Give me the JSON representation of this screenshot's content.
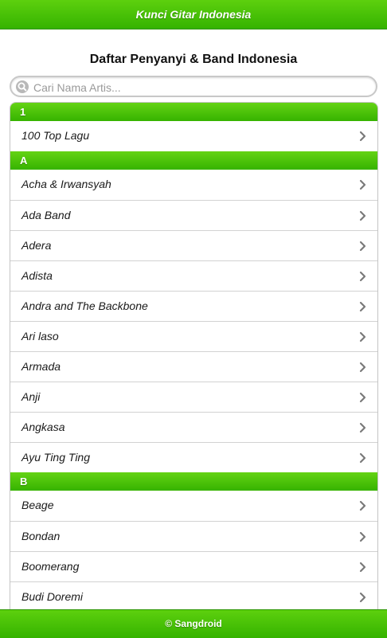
{
  "header": {
    "title": "Kunci Gitar Indonesia"
  },
  "page": {
    "title": "Daftar Penyanyi & Band Indonesia"
  },
  "search": {
    "placeholder": "Cari Nama Artis...",
    "value": ""
  },
  "sections": [
    {
      "label": "1",
      "items": [
        "100 Top Lagu"
      ]
    },
    {
      "label": "A",
      "items": [
        "Acha & Irwansyah",
        "Ada Band",
        "Adera",
        "Adista",
        "Andra and The Backbone",
        "Ari laso",
        "Armada",
        "Anji",
        "Angkasa",
        "Ayu Ting Ting"
      ]
    },
    {
      "label": "B",
      "items": [
        "Beage",
        "Bondan",
        "Boomerang",
        "Budi Doremi"
      ]
    }
  ],
  "footer": {
    "text": "© Sangdroid"
  },
  "colors": {
    "accent": "#3cb800",
    "divider_text": "#ffffff",
    "chevron": "#7a7a7a"
  }
}
